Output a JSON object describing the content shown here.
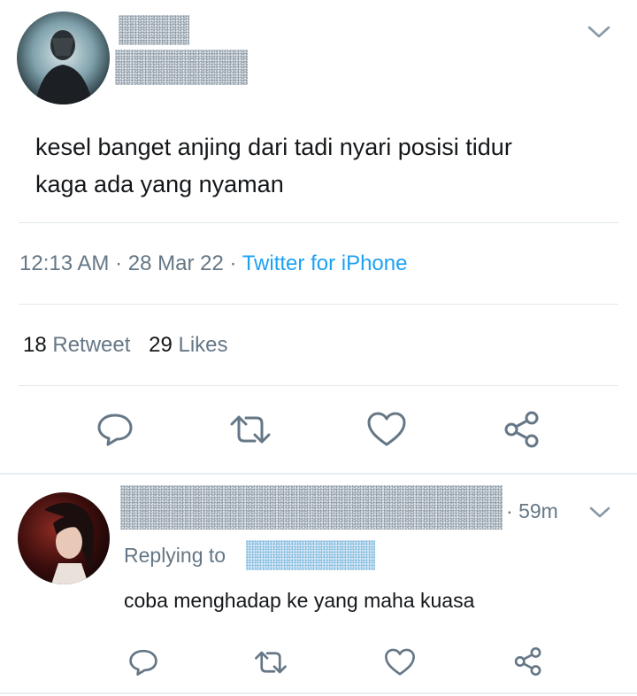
{
  "tweet": {
    "text_line1": "kesel banget anjing dari tadi nyari posisi tidur",
    "text_line2": "kaga ada yang nyaman",
    "time": "12:13 AM",
    "date": "28 Mar 22",
    "source": "Twitter for iPhone",
    "retweet_count": "18",
    "retweet_label": "Retweet",
    "like_count": "29",
    "like_label": "Likes",
    "menu_icon": "chevron-down-icon"
  },
  "actions": [
    "reply-icon",
    "retweet-icon",
    "like-icon",
    "share-icon"
  ],
  "reply": {
    "age": "59m",
    "replying_to_label": "Replying to",
    "text": "coba menghadap ke yang maha kuasa"
  },
  "colors": {
    "text": "#14171a",
    "secondary": "#657786",
    "link": "#1da1f2",
    "divider": "#e1e8ed"
  }
}
